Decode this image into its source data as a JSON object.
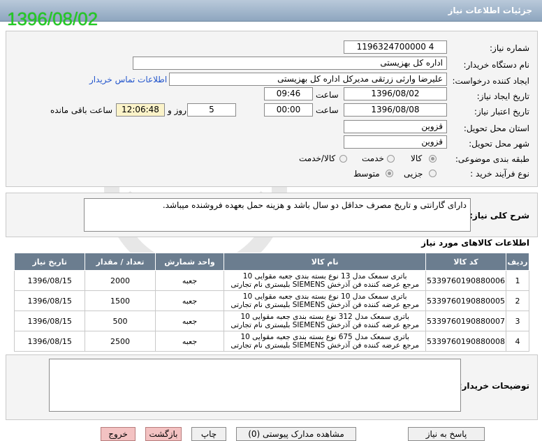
{
  "window": {
    "title": "جزئیات اطلاعات نیاز"
  },
  "datestamp": "1396/08/02",
  "form": {
    "need_number_label": "شماره نیاز:",
    "need_number": "1196324700000 4",
    "buyer_label": "نام دستگاه خریدار:",
    "buyer": "اداره کل بهزیستی",
    "creator_label": "ایجاد کننده درخواست:",
    "creator": "علیرضا وارثی زرتقی مدیرکل اداره کل بهزیستی",
    "contact_link": "اطلاعات تماس خریدار",
    "created_label": "تاریخ ایجاد نیاز:",
    "created_date": "1396/08/02",
    "time_label": "ساعت",
    "created_time": "09:46",
    "validity_label": "تاریخ اعتبار نیاز:",
    "validity_date": "1396/08/08",
    "validity_time": "00:00",
    "days": "5",
    "days_label": "روز و",
    "remaining": "12:06:48",
    "remaining_label": "ساعت باقی مانده",
    "province_label": "استان محل تحویل:",
    "province": "قزوین",
    "city_label": "شهر محل تحویل:",
    "city": "قزوین",
    "category_label": "طبقه بندی موضوعی:",
    "category_options": [
      "کالا",
      "خدمت",
      "کالا/خدمت"
    ],
    "process_label": "نوع فرآیند خرید :",
    "process_options": [
      "جزیی",
      "متوسط"
    ]
  },
  "description": {
    "label": "شرح کلی نیاز:",
    "text": "دارای گارانتی و تاریخ مصرف حداقل دو سال باشد و هزینه حمل بعهده فروشنده میباشد."
  },
  "items": {
    "title": "اطلاعات کالاهای مورد نیاز",
    "headers": [
      "ردیف",
      "کد کالا",
      "نام کالا",
      "واحد شمارش",
      "تعداد / مقدار",
      "تاریخ نیاز"
    ],
    "rows": [
      {
        "row": "1",
        "code": "5339760190880006",
        "name1": "باتری سمعک مدل 13 نوع بسته بندی جعبه مقوایی 10",
        "name2": "بلیستری نام تجارتی SIEMENS مرجع عرضه کننده فن آذرخش",
        "unit": "جعبه",
        "qty": "2000",
        "date": "1396/08/15"
      },
      {
        "row": "2",
        "code": "5339760190880005",
        "name1": "باتری سمعک مدل 10 نوع بسته بندی جعبه مقوایی 10",
        "name2": "بلیستری نام تجارتی SIEMENS مرجع عرضه کننده فن آذرخش",
        "unit": "جعبه",
        "qty": "1500",
        "date": "1396/08/15"
      },
      {
        "row": "3",
        "code": "5339760190880007",
        "name1": "باتری سمعک مدل 312 نوع بسته بندی جعبه مقوایی 10",
        "name2": "بلیستری نام تجارتی SIEMENS مرجع عرضه کننده فن آذرخش",
        "unit": "جعبه",
        "qty": "500",
        "date": "1396/08/15"
      },
      {
        "row": "4",
        "code": "5339760190880008",
        "name1": "باتری سمعک مدل 675 نوع بسته بندی جعبه مقوایی 10",
        "name2": "بلیستری نام تجارتی SIEMENS مرجع عرضه کننده فن آذرخش",
        "unit": "جعبه",
        "qty": "2500",
        "date": "1396/08/15"
      }
    ]
  },
  "buyer_notes": {
    "label": "توضیحات خریدار:",
    "text": ""
  },
  "buttons": {
    "reply": "پاسخ به نیاز",
    "attachments": "مشاهده مدارک پیوستی (0)",
    "print": "چاپ",
    "back": "بازگشت",
    "exit": "خروج"
  },
  "colors": {
    "header": "#6b7d8f",
    "titlebar": "#8ea6bf",
    "datestamp": "#22cc22"
  }
}
